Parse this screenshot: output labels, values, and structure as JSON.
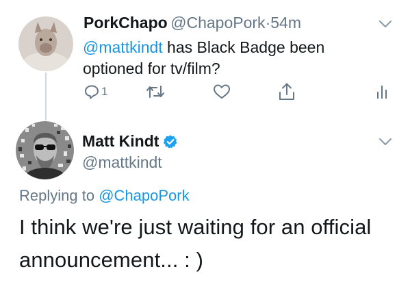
{
  "tweet1": {
    "display_name": "PorkChapo",
    "handle": "@ChapoPork",
    "separator": "·",
    "time": "54m",
    "mention": "@mattkindt",
    "text_line1_rest": " has Black Badge been",
    "text_line2": "optioned for tv/film?",
    "reply_count": "1"
  },
  "tweet2": {
    "display_name": "Matt Kindt",
    "handle": "@mattkindt",
    "replying_prefix": "Replying to ",
    "replying_handle": "@ChapoPork",
    "text_line1": "I think we're just waiting for an official",
    "text_line2": "announcement... : )"
  },
  "colors": {
    "accent": "#1b95e0",
    "verified": "#1da1f2",
    "muted": "#657786"
  },
  "icons": [
    "reply-icon",
    "retweet-icon",
    "like-icon",
    "share-icon",
    "analytics-icon",
    "chevron-down-icon",
    "verified-badge-icon"
  ]
}
